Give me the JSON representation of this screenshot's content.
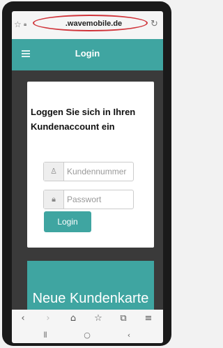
{
  "browser": {
    "url": ".wavemobile.de",
    "bookmark_icon": "star-outline-icon",
    "lock_icon": "lock-icon",
    "reload_icon": "reload-icon",
    "url_highlight_color": "#d0343a"
  },
  "header": {
    "title": "Login",
    "menu_icon": "hamburger-menu-icon",
    "color": "#3fa5a1"
  },
  "login": {
    "heading": "Loggen Sie sich in Ihren Kundenaccount ein",
    "customer_number_placeholder": "Kundennummer",
    "password_placeholder": "Passwort",
    "button_label": "Login"
  },
  "promo": {
    "title": "Neue Kundenkarte"
  },
  "nav": {
    "back": "‹",
    "forward": "›",
    "home": "⌂",
    "bookmarks": "☆",
    "tabs": "⧉",
    "menu": "≡"
  },
  "system_nav": {
    "recents": "⦀",
    "home": "○",
    "back": "‹"
  }
}
